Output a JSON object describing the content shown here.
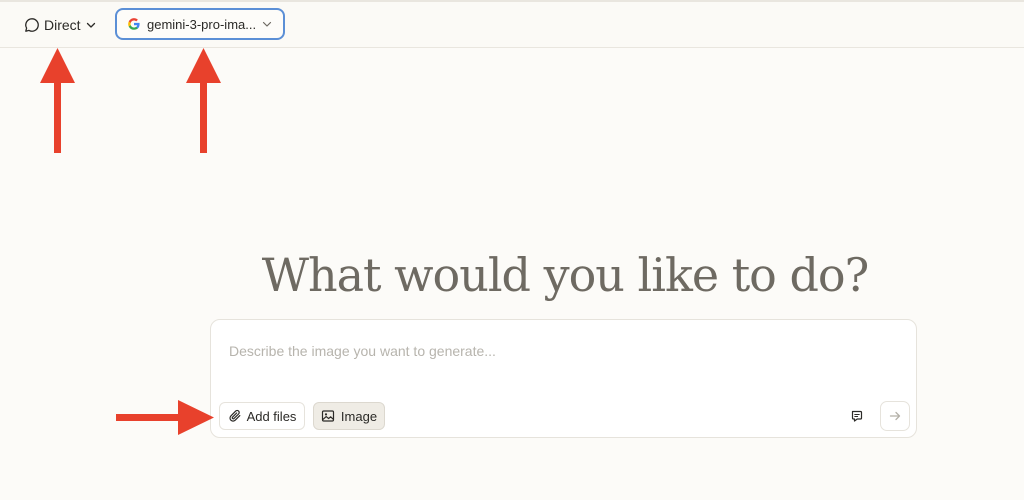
{
  "header": {
    "mode_label": "Direct",
    "model_label": "gemini-3-pro-ima...",
    "icons": {
      "mode": "chat-bubble-icon",
      "mode_chevron": "chevron-down-icon",
      "model_brand": "google-g-icon",
      "model_chevron": "chevron-down-icon"
    }
  },
  "main": {
    "headline": "What would you like to do?"
  },
  "composer": {
    "placeholder": "Describe the image you want to generate...",
    "value": "",
    "add_files_label": "Add files",
    "image_label": "Image",
    "icons": {
      "add_files": "paperclip-icon",
      "image": "image-icon",
      "prompt_library": "prompt-library-icon",
      "send": "arrow-right-icon"
    }
  },
  "annotations": {
    "arrow_color": "#e8412c",
    "arrows": [
      "arrow-up-to-mode",
      "arrow-up-to-model",
      "arrow-right-to-add-files"
    ]
  },
  "colors": {
    "background": "#fcfbf8",
    "model_border": "#5b8fd6",
    "headline_text": "#6e6a62",
    "placeholder_text": "#b7b4ad"
  }
}
